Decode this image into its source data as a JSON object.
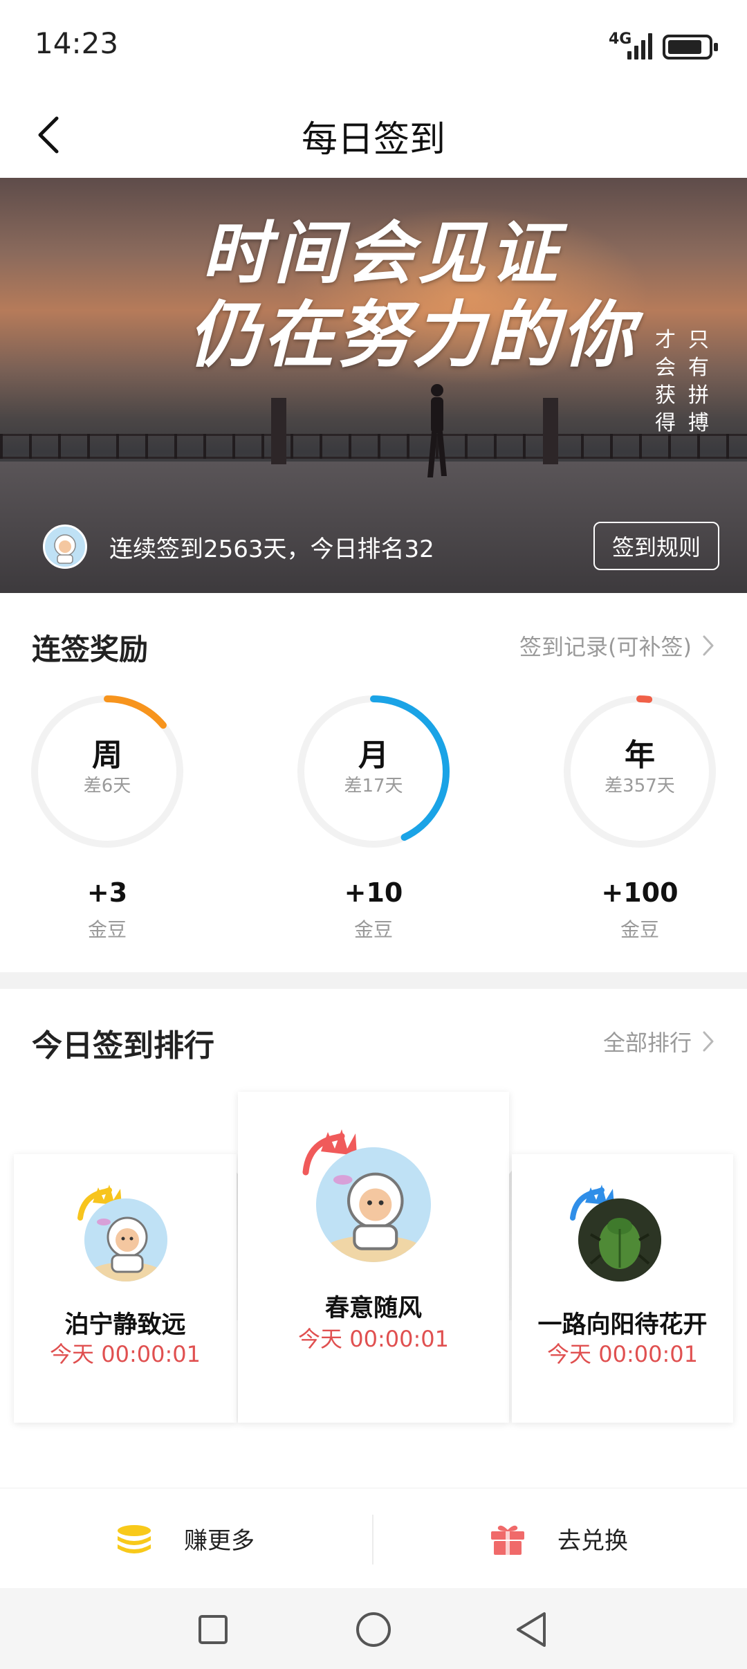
{
  "status_bar": {
    "time": "14:23",
    "network": "4G"
  },
  "header": {
    "title": "每日签到"
  },
  "banner": {
    "slogan_line1": "时间会见证",
    "slogan_line2": "仍在努力的你",
    "side_col1": [
      "只",
      "有",
      "拼",
      "搏"
    ],
    "side_col2": [
      "才",
      "会",
      "获",
      "得"
    ],
    "user_status": "连续签到2563天，今日排名32",
    "rules_button": "签到规则"
  },
  "streak": {
    "title": "连签奖励",
    "record_link": "签到记录(可补签)",
    "items": [
      {
        "name": "周",
        "remaining": "差6天",
        "bonus": "+3",
        "unit": "金豆",
        "progress": 0.14,
        "color": "#f7941d"
      },
      {
        "name": "月",
        "remaining": "差17天",
        "bonus": "+10",
        "unit": "金豆",
        "progress": 0.43,
        "color": "#1aa3e6"
      },
      {
        "name": "年",
        "remaining": "差357天",
        "bonus": "+100",
        "unit": "金豆",
        "progress": 0.02,
        "color": "#f06048"
      }
    ]
  },
  "ranking": {
    "title": "今日签到排行",
    "all_link": "全部排行",
    "entries": [
      {
        "name": "春意随风",
        "time": "今天 00:00:01",
        "crown_color": "#f05a5a"
      },
      {
        "name": "泊宁静致远",
        "time": "今天 00:00:01",
        "crown_color": "#f7c41d"
      },
      {
        "name": "一路向阳待花开",
        "time": "今天 00:00:01",
        "crown_color": "#2f8ee8"
      }
    ]
  },
  "bottom_actions": {
    "earn_more": "赚更多",
    "redeem": "去兑换"
  },
  "colors": {
    "accent_red": "#e05050",
    "coin_yellow": "#f8c91a",
    "gift_red": "#f06a6a"
  }
}
